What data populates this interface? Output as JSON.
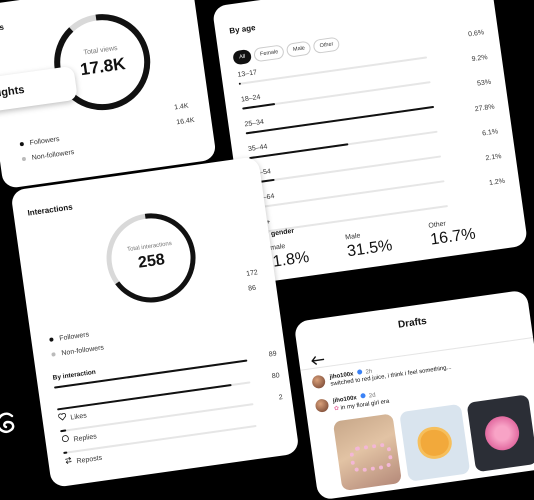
{
  "views_card": {
    "ring_label": "Total views",
    "ring_value": "17.8K",
    "header_fragment": "s",
    "stat_values": [
      "1.4K",
      "16.4K"
    ],
    "legend": [
      "Followers",
      "Non-followers"
    ],
    "ring_progress": 0.9
  },
  "insights_pill": {
    "label": "ights"
  },
  "age_card": {
    "title": "By age",
    "filters": [
      "All",
      "Female",
      "Male",
      "Other"
    ],
    "active_filter": "All",
    "groups": [
      {
        "label": "13–17",
        "value": "0.6%",
        "pct": 0.6
      },
      {
        "label": "18–24",
        "value": "9.2%",
        "pct": 9.2
      },
      {
        "label": "25–34",
        "value": "53%",
        "pct": 53
      },
      {
        "label": "35–44",
        "value": "27.8%",
        "pct": 27.8
      },
      {
        "label": "45–54",
        "value": "6.1%",
        "pct": 6.1
      },
      {
        "label": "55–64",
        "value": "2.1%",
        "pct": 2.1
      },
      {
        "label": "65+",
        "value": "1.2%",
        "pct": 1.2
      }
    ],
    "gender_title": "By gender",
    "genders": [
      {
        "label": "Female",
        "value": "51.8%"
      },
      {
        "label": "Male",
        "value": "31.5%"
      },
      {
        "label": "Other",
        "value": "16.7%"
      }
    ]
  },
  "interactions_card": {
    "title": "Interactions",
    "ring_label": "Total interactions",
    "ring_value": "258",
    "ring_progress": 0.67,
    "stat_values": [
      "172",
      "86"
    ],
    "legend": [
      "Followers",
      "Non-followers"
    ],
    "by_interaction_title": "By interaction",
    "items": [
      {
        "label": "",
        "value": "89",
        "fraction": 1.0
      },
      {
        "label": "Likes",
        "value": "80",
        "fraction": 0.9,
        "icon": "heart-icon"
      },
      {
        "label": "Replies",
        "value": "2",
        "fraction": 0.03,
        "icon": "reply-icon"
      },
      {
        "label": "Reposts",
        "value": "",
        "fraction": 0.02,
        "icon": "repost-icon"
      }
    ]
  },
  "drafts_card": {
    "title": "Drafts",
    "drafts": [
      {
        "user": "jiho100x",
        "time": "2h",
        "text": "switched to red juice, i think i feel something..."
      },
      {
        "user": "jiho100x",
        "time": "2d",
        "text": "in my floral girl era"
      }
    ]
  },
  "colors": {
    "background": "#000000",
    "card": "#ffffff",
    "accent": "#111111",
    "verified": "#3b82f6"
  }
}
